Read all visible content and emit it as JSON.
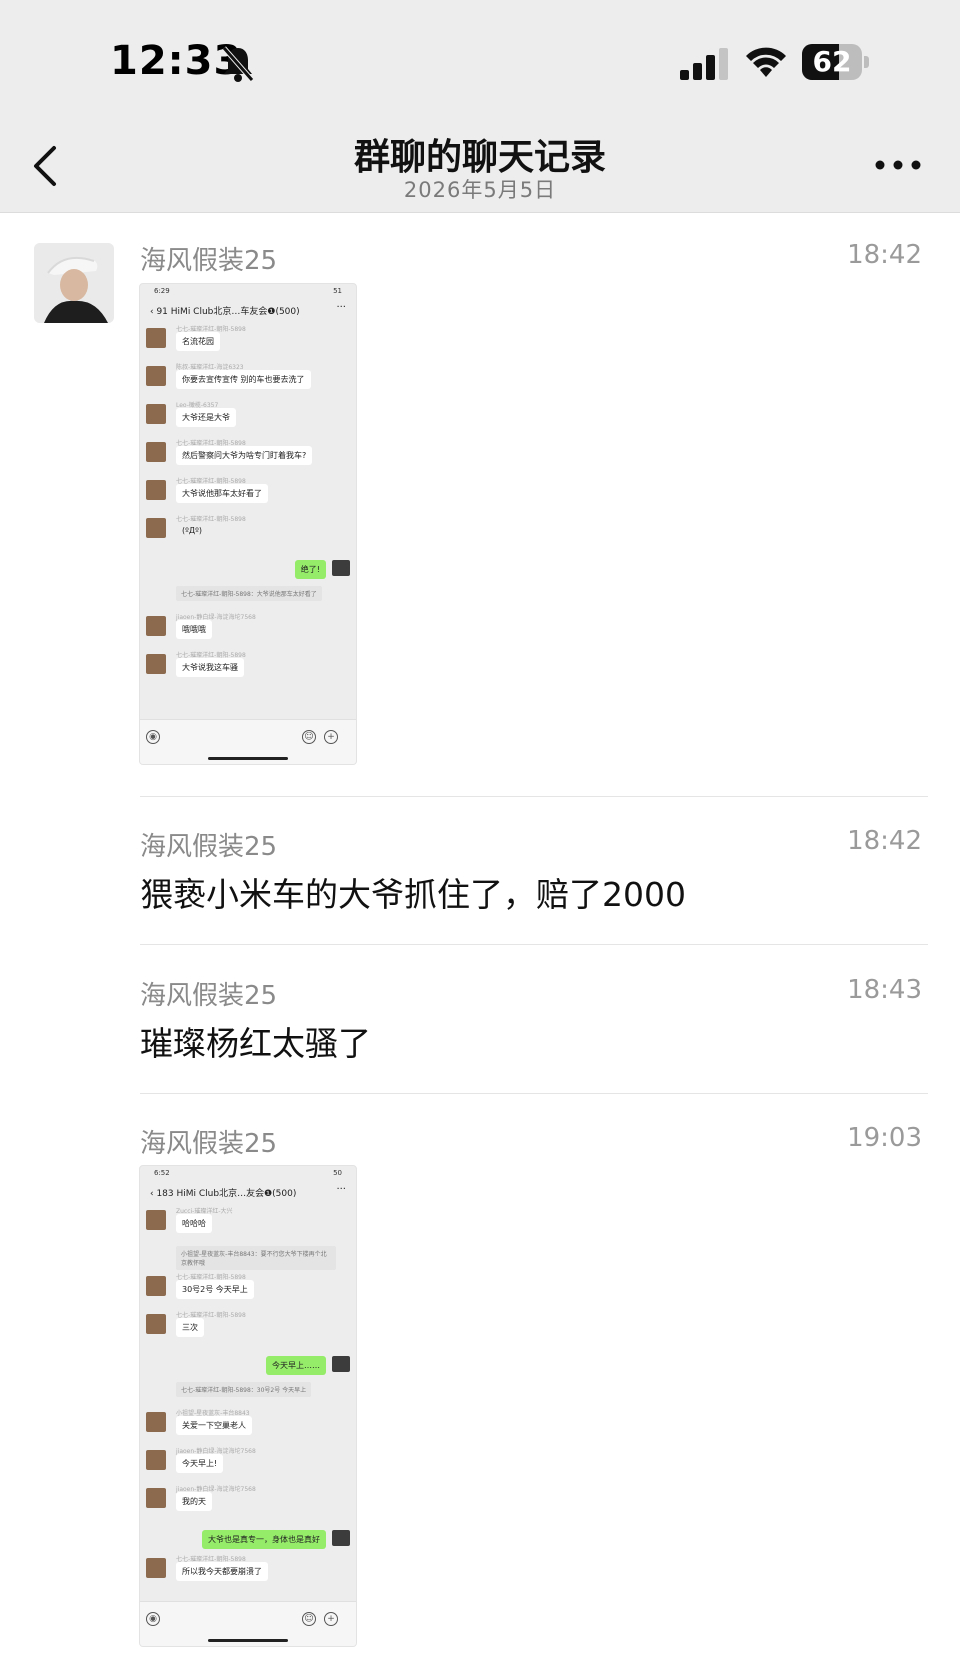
{
  "status_bar": {
    "time": "12:33",
    "battery": "62",
    "battery_level": 0.62
  },
  "nav": {
    "title": "群聊的聊天记录",
    "subtitle": "2026年5月5日",
    "back_icon": "chevron-left-icon",
    "more_icon": "ellipsis-icon"
  },
  "messages": [
    {
      "sender": "海风假装25",
      "time": "18:42",
      "screenshot": {
        "status_time": "6:29",
        "status_right": "51",
        "title": "HiMi Club北京…车友会❶(500)",
        "back": "91",
        "rows": [
          {
            "name": "七七-璀璨洋红-朝阳-5898",
            "text": "名流花园"
          },
          {
            "name": "陈叔-璀璨洋红-海淀6323",
            "text": "你要去宣传宣传 别的车也要去洗了"
          },
          {
            "name": "Leo-橄榄-6357",
            "text": "大爷还是大爷"
          },
          {
            "name": "七七-璀璨洋红-朝阳-5898",
            "text": "然后警察问大爷为啥专门盯着我车?"
          },
          {
            "name": "七七-璀璨洋红-朝阳-5898",
            "text": "大爷说他那车太好看了"
          },
          {
            "name": "七七-璀璨洋红-朝阳-5898",
            "text": ""
          },
          {
            "name": "",
            "text": "绝了!"
          },
          {
            "name": "",
            "text": "七七-璀璨洋红-朝阳-5898：大爷说他那车太好看了"
          },
          {
            "name": "jiaoen-静白绿-海淀海坨7568",
            "text": "哦哦哦"
          },
          {
            "name": "七七-璀璨洋红-朝阳-5898",
            "text": "大爷说我这车骚"
          }
        ]
      }
    },
    {
      "sender": "海风假装25",
      "time": "18:42",
      "text": "猥亵小米车的大爷抓住了，赔了2000"
    },
    {
      "sender": "海风假装25",
      "time": "18:43",
      "text": "璀璨杨红太骚了"
    },
    {
      "sender": "海风假装25",
      "time": "19:03",
      "screenshot": {
        "status_time": "6:52",
        "status_right": "50",
        "title": "HiMi Club北京…友会❶(500)",
        "back": "183",
        "rows": [
          {
            "name": "Zucci-璀璨洋红-大兴",
            "text": "哈哈哈"
          },
          {
            "name": "",
            "text": "小祖望-星夜蓝灰-丰台8843：要不行您大爷下楼再个北京教怀哦"
          },
          {
            "name": "七七-璀璨洋红-朝阳-5898",
            "text": "30号2号 今天早上"
          },
          {
            "name": "七七-璀璨洋红-朝阳-5898",
            "text": "三次"
          },
          {
            "name": "",
            "text": "今天早上……"
          },
          {
            "name": "",
            "text": "七七-璀璨洋红-朝阳-5898：30号2号 今天早上"
          },
          {
            "name": "小祖望-星夜蓝灰-丰台8843",
            "text": "关爱一下空巢老人"
          },
          {
            "name": "jiaoen-静白绿-海淀海坨7568",
            "text": "今天早上!"
          },
          {
            "name": "jiaoen-静白绿-海淀海坨7568",
            "text": "我的天"
          },
          {
            "name": "",
            "text": "大爷也是真专一，身体也是真好"
          },
          {
            "name": "七七-璀璨洋红-朝阳-5898",
            "text": "所以我今天都要崩溃了"
          }
        ]
      }
    }
  ]
}
